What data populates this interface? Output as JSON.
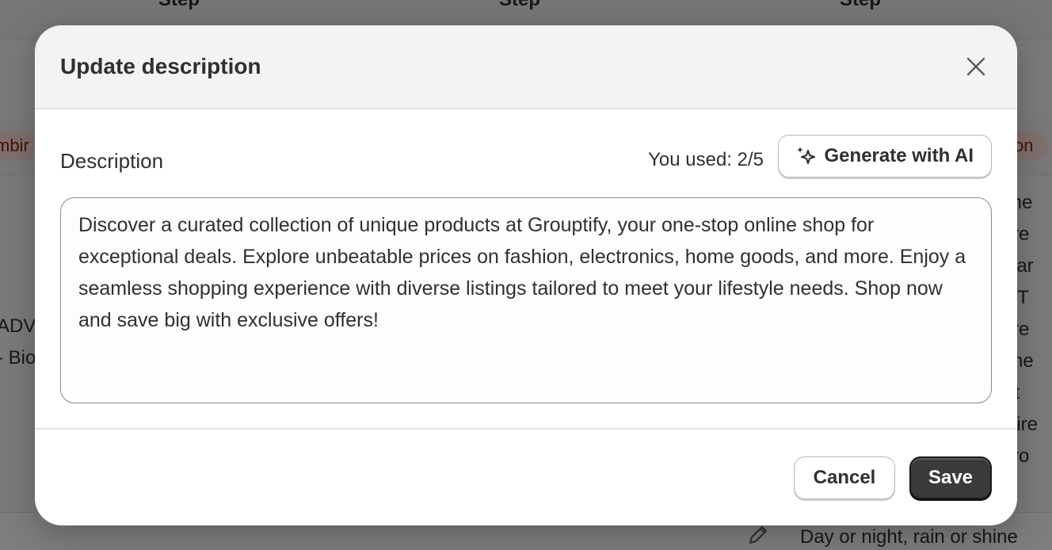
{
  "background": {
    "header_labels": [
      "Step",
      "Step",
      "Step"
    ],
    "left_badge": "mbir",
    "right_badge": "on",
    "left_lines": [
      "ADV",
      "- Bio"
    ],
    "right_lines": [
      "hine",
      "ture",
      ", car",
      "e. T",
      "ture",
      "o he",
      "wit",
      "spire",
      "thro"
    ],
    "bottom_row_text": "Day or night, rain or shine"
  },
  "modal": {
    "title": "Update description",
    "field_label": "Description",
    "usage_text": "You used: 2/5",
    "generate_button_label": "Generate with AI",
    "description_value": "Discover a curated collection of unique products at Grouptify, your one-stop online shop for exceptional deals. Explore unbeatable prices on fashion, electronics, home goods, and more. Enjoy a seamless shopping experience with diverse listings tailored to meet your lifestyle needs. Shop now and save big with exclusive offers!",
    "cancel_label": "Cancel",
    "save_label": "Save"
  },
  "icons": {
    "close": "close-icon",
    "sparkle": "sparkle-icon",
    "pencil": "pencil-icon"
  },
  "colors": {
    "primary_button": "#3a3a3a",
    "badge_bg": "#fde0dc",
    "badge_text": "#8e1f0b",
    "overlay": "rgba(0,0,0,0.5)"
  }
}
